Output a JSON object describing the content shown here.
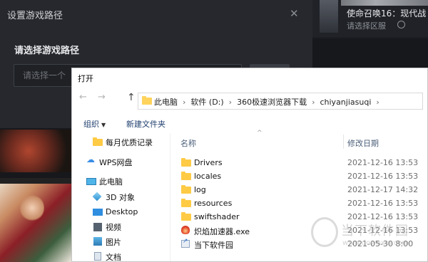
{
  "background_app": {
    "game_title": "使命召唤16：现代战",
    "region_select": "请选择区服"
  },
  "settings_dialog": {
    "title": "设置游戏路径",
    "close": "✕",
    "subtitle": "请选择游戏路径",
    "path_placeholder": "请选择一个"
  },
  "explorer": {
    "title": "打开",
    "nav": {
      "back": "←",
      "forward": "→",
      "up": "↑"
    },
    "breadcrumbs": [
      "此电脑",
      "软件 (D:)",
      "360极速浏览器下载",
      "chiyanjiasuqi"
    ],
    "toolbar": {
      "organize": "组织",
      "new_folder": "新建文件夹"
    },
    "tree": [
      {
        "label": "每月优质记录",
        "icon": "folder-icon"
      },
      {
        "label": "WPS网盘",
        "icon": "cloud-icon"
      },
      {
        "label": "此电脑",
        "icon": "computer-icon"
      },
      {
        "label": "3D 对象",
        "icon": "3d-objects-icon"
      },
      {
        "label": "Desktop",
        "icon": "desktop-icon"
      },
      {
        "label": "视频",
        "icon": "video-icon"
      },
      {
        "label": "图片",
        "icon": "pictures-icon"
      },
      {
        "label": "文档",
        "icon": "documents-icon"
      }
    ],
    "columns": {
      "name": "名称",
      "modified": "修改日期"
    },
    "files": [
      {
        "name": "Drivers",
        "date": "2021-12-16 13:53",
        "icon": "folder-icon"
      },
      {
        "name": "locales",
        "date": "2021-12-16 13:53",
        "icon": "folder-icon"
      },
      {
        "name": "log",
        "date": "2021-12-17 14:32",
        "icon": "folder-icon"
      },
      {
        "name": "resources",
        "date": "2021-12-16 13:53",
        "icon": "folder-icon"
      },
      {
        "name": "swiftshader",
        "date": "2021-12-16 13:53",
        "icon": "folder-icon"
      },
      {
        "name": "炽焰加速器.exe",
        "date": "2021-12-16 13:53",
        "icon": "exe-icon"
      },
      {
        "name": "当下软件园",
        "date": "2021-05-30 8:00",
        "icon": "shortcut-icon"
      }
    ]
  },
  "watermark": {
    "text": "当下软件园",
    "url": "www.downxia.com"
  }
}
